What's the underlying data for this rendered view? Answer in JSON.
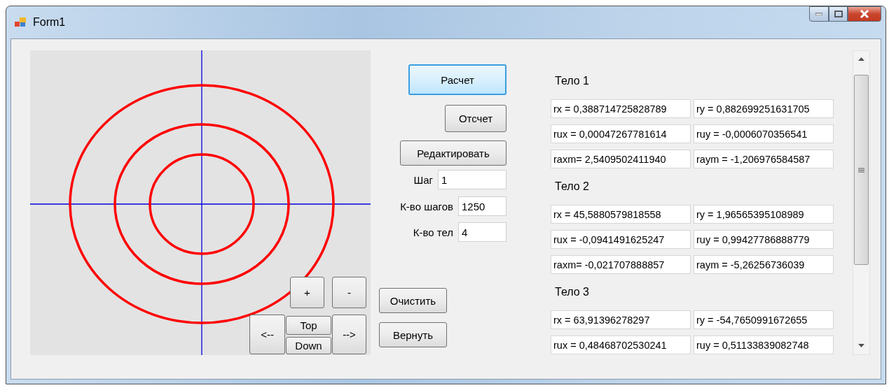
{
  "window": {
    "title": "Form1"
  },
  "pan_buttons": {
    "zoom_in": "+",
    "zoom_out": "-",
    "left": "<--",
    "up": "Top",
    "down": "Down",
    "right": "-->"
  },
  "actions": [
    {
      "label": "Расчет",
      "focused": true
    },
    {
      "label": "Отсчет",
      "focused": false
    },
    {
      "label": "Редактировать",
      "focused": false
    }
  ],
  "params": [
    {
      "label": "Шаг",
      "value": "1"
    },
    {
      "label": "К-во шагов",
      "value": "1250"
    },
    {
      "label": "К-во тел",
      "value": "4"
    }
  ],
  "bottom_buttons": [
    "Очистить",
    "Вернуть"
  ],
  "bodies": [
    {
      "label": "Тело 1",
      "rows": [
        [
          "rx = 0,388714725828789",
          "ry = 0,882699251631705"
        ],
        [
          "rux = 0,00047267781614",
          "ruy = -0,0006070356541"
        ],
        [
          "raxm= 2,5409502411940",
          "raym = -1,206976584587"
        ]
      ]
    },
    {
      "label": "Тело 2",
      "rows": [
        [
          "rx = 45,5880579818558",
          "ry = 1,96565395108989"
        ],
        [
          "rux = -0,0941491625247",
          "ruy = 0,99427786888779"
        ],
        [
          "raxm= -0,021707888857",
          "raym = -5,26256736039"
        ]
      ]
    },
    {
      "label": "Тело 3",
      "rows": [
        [
          "rx = 63,91396278297",
          "ry = -54,7650991672655"
        ],
        [
          "rux = 0,48468702530241",
          "ruy = 0,51133839082748"
        ]
      ]
    }
  ]
}
